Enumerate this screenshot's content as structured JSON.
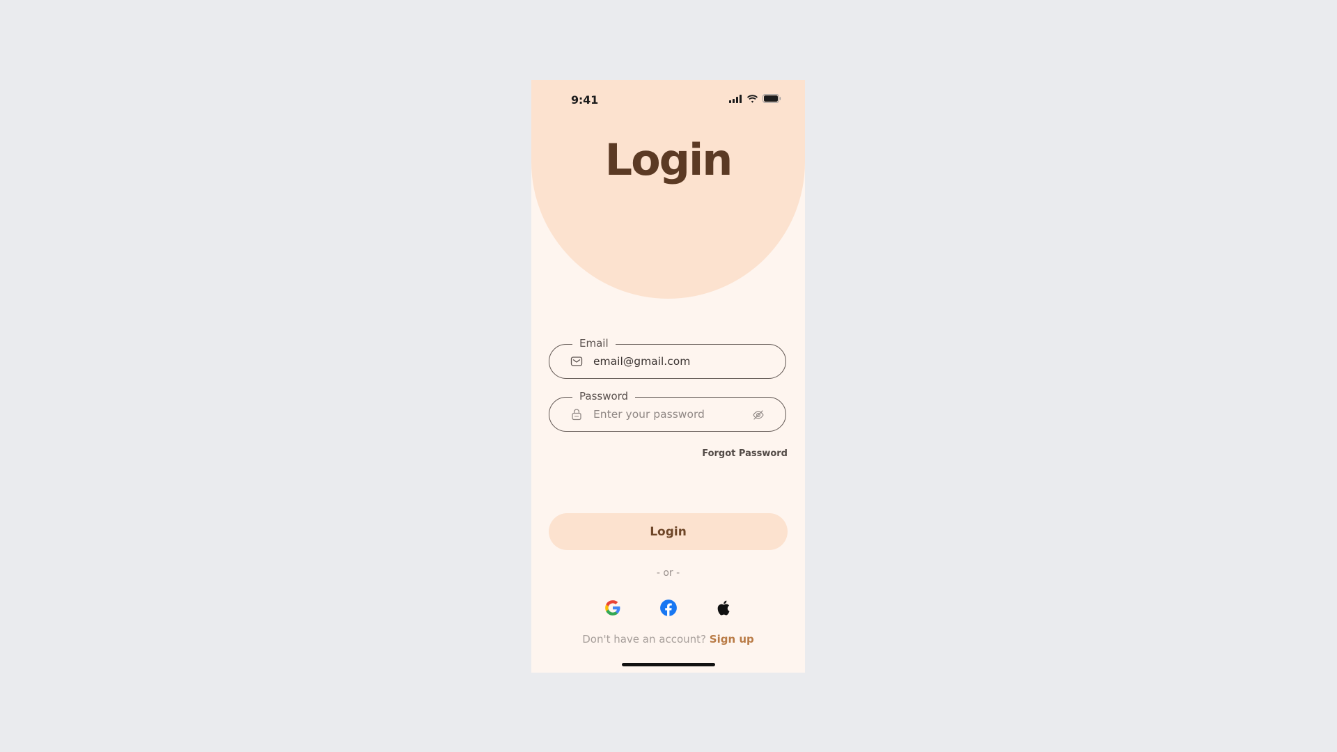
{
  "status_bar": {
    "time": "9:41",
    "icons": [
      "cellular-signal-icon",
      "wifi-icon",
      "battery-icon"
    ]
  },
  "header": {
    "title": "Login"
  },
  "form": {
    "email": {
      "label": "Email",
      "value": "email@gmail.com",
      "icon": "mail-icon"
    },
    "password": {
      "label": "Password",
      "placeholder": "Enter your password",
      "icon": "lock-icon",
      "toggle_icon": "eye-off-icon"
    },
    "forgot_label": "Forgot Password",
    "submit_label": "Login"
  },
  "divider": {
    "text": "- or -"
  },
  "social_login": [
    "google-icon",
    "facebook-icon",
    "apple-icon"
  ],
  "signup": {
    "prompt": "Don't have an account?",
    "link": "Sign up"
  },
  "colors": {
    "background": "#fef5ef",
    "accent": "#fce2cf",
    "title": "#5b3a24",
    "button_text": "#6e4628",
    "link": "#b97b46",
    "outer": "#eaebee"
  }
}
